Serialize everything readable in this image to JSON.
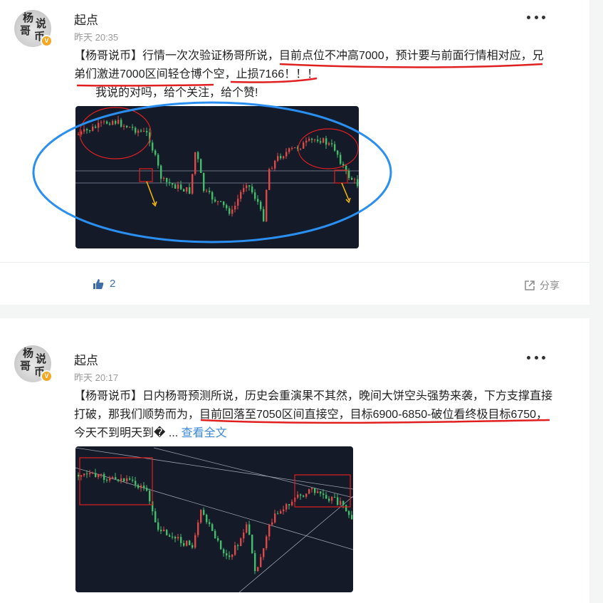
{
  "posts": [
    {
      "author": "起点",
      "time": "昨天 20:35",
      "avatar_text": "杨说哥币",
      "verified_badge": "V",
      "text_lines": [
        "【杨哥说币】行情一次次验证杨哥所说，目前点位不冲高7000，预计要与前面行情相对应，兄",
        "弟们激进7000区间轻仓博个空，止损7166！！！",
        "我说的对吗，给个关注，给个赞!"
      ],
      "likes": "2",
      "share_label": "分享",
      "icons": {
        "like": "thumbs-up-icon",
        "share": "share-icon",
        "more": "more-dots-icon"
      }
    },
    {
      "author": "起点",
      "time": "昨天 20:17",
      "avatar_text": "杨说哥币",
      "verified_badge": "V",
      "text_lines": [
        "【杨哥说币】日内杨哥预测所说，历史会重演果不其然，晚间大饼空头强势来袭，下方支撑直接",
        "打破，那我们顺势而为，目前回落至7050区间直接空，目标6900-6850-破位看终极目标6750，",
        "今天不到明天到� ..."
      ],
      "read_more": "查看全文",
      "icons": {
        "more": "more-dots-icon"
      }
    }
  ],
  "colors": {
    "chart_bg": "#141a28",
    "candle_up": "#e04848",
    "candle_down": "#3cc06a",
    "annotation_red": "#e02020",
    "annotation_blue": "#2a8ff0",
    "arrow_yellow": "#f0b400",
    "link_blue": "#3d8ad6"
  }
}
